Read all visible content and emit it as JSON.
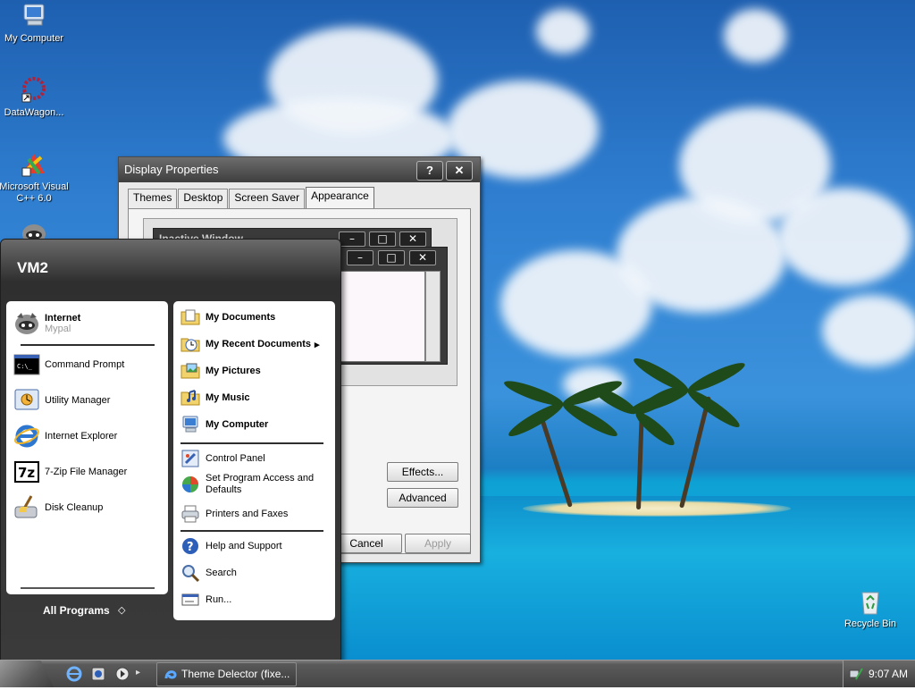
{
  "desktop": {
    "icons": [
      {
        "label": "My Computer",
        "icon": "my-computer-icon"
      },
      {
        "label": "DataWagon...",
        "icon": "datawagon-shortcut-icon"
      },
      {
        "label": "Microsoft Visual C++ 6.0",
        "icon": "visual-cpp-shortcut-icon"
      },
      {
        "label": "",
        "icon": "raccoon-icon"
      },
      {
        "label": "Recycle Bin",
        "icon": "recycle-bin-icon"
      }
    ]
  },
  "display_properties": {
    "title": "Display Properties",
    "help_label": "?",
    "close_label": "✕",
    "tabs": [
      "Themes",
      "Desktop",
      "Screen Saver",
      "Appearance"
    ],
    "active_tab": "Appearance",
    "preview": {
      "inactive_window_title": "Inactive Window",
      "min_label": "–",
      "max_label": "□",
      "close_label": "✕"
    },
    "effects_label": "Effects...",
    "advanced_label": "Advanced",
    "cancel_label": "Cancel",
    "apply_label": "Apply"
  },
  "start_menu": {
    "user": "VM2",
    "pinned": [
      {
        "label": "Internet",
        "sub": "Mypal",
        "icon": "raccoon-browser-icon"
      }
    ],
    "recent": [
      {
        "label": "Command Prompt",
        "icon": "command-prompt-icon"
      },
      {
        "label": "Utility Manager",
        "icon": "utility-manager-icon"
      },
      {
        "label": "Internet Explorer",
        "icon": "internet-explorer-icon"
      },
      {
        "label": "7-Zip File Manager",
        "icon": "7zip-icon"
      },
      {
        "label": "Disk Cleanup",
        "icon": "disk-cleanup-icon"
      }
    ],
    "all_programs": "All Programs",
    "places": [
      {
        "label": "My Documents",
        "icon": "folder-documents-icon"
      },
      {
        "label": "My Recent Documents",
        "icon": "recent-documents-icon",
        "arrow": "▸"
      },
      {
        "label": "My Pictures",
        "icon": "folder-pictures-icon"
      },
      {
        "label": "My Music",
        "icon": "folder-music-icon"
      },
      {
        "label": "My Computer",
        "icon": "my-computer-icon"
      }
    ],
    "system": [
      {
        "label": "Control Panel",
        "icon": "control-panel-icon"
      },
      {
        "label": "Set Program Access and Defaults",
        "icon": "program-access-icon"
      },
      {
        "label": "Printers and Faxes",
        "icon": "printer-icon"
      }
    ],
    "tools": [
      {
        "label": "Help and Support",
        "icon": "help-icon"
      },
      {
        "label": "Search",
        "icon": "search-icon"
      },
      {
        "label": "Run...",
        "icon": "run-icon"
      }
    ]
  },
  "taskbar": {
    "quick_launch": [
      "internet-explorer-icon",
      "media-icon",
      "arrow-icon"
    ],
    "task_label": "Theme Delector (fixe...",
    "clock": "9:07 AM"
  },
  "colors": {
    "chrome_dark": "#3e3e3e",
    "chrome_light": "#6d6d6d",
    "sky": "#2f7ed0",
    "sea": "#18b0df"
  }
}
